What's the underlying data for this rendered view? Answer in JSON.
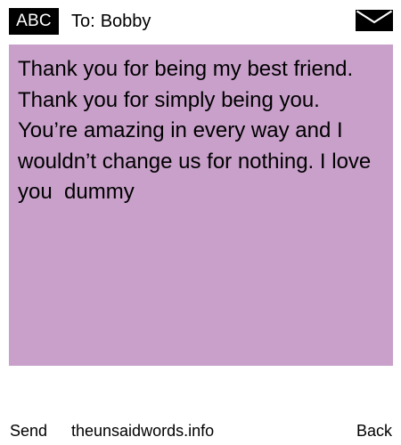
{
  "header": {
    "badge_label": "ABC",
    "to_label": "To:",
    "recipient": "Bobby",
    "envelope_icon": "envelope-icon"
  },
  "message": {
    "background_color": "#c8a0ca",
    "text": "Thank you for being my best friend. Thank you for simply being you. You’re amazing in every way and I wouldn’t change us for nothing. I love you  dummy"
  },
  "footer": {
    "send_label": "Send",
    "site_label": "theunsaidwords.info",
    "back_label": "Back"
  }
}
